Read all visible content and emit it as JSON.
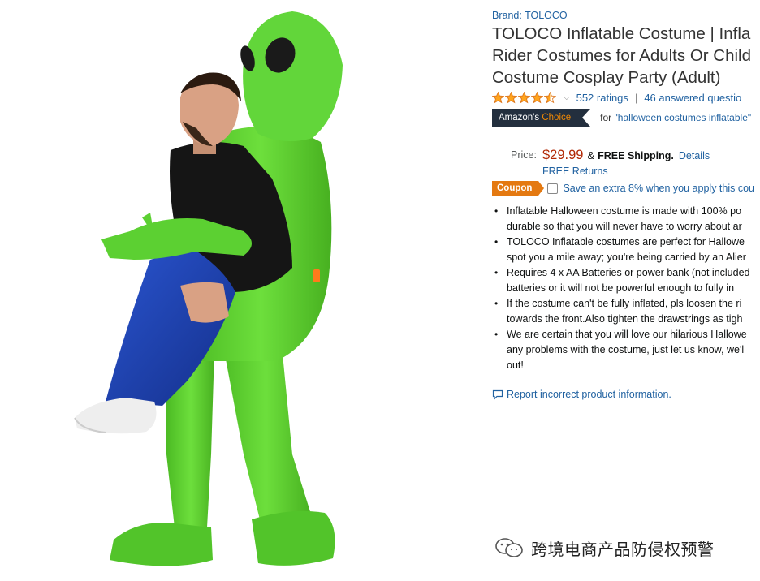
{
  "product": {
    "brand_label": "Brand: TOLOCO",
    "title_lines": [
      "TOLOCO Inflatable Costume | Infla",
      "Rider Costumes for Adults Or Child",
      "Costume Cosplay Party (Adult)"
    ],
    "rating": {
      "stars_value": 4.5,
      "stars_max": 5,
      "ratings_text": "552 ratings",
      "separator": "|",
      "answered_text": "46 answered questio"
    },
    "badge": {
      "prefix": "Amazon's",
      "highlight": "Choice",
      "for_text": "for",
      "keyword_quoted": "\"halloween costumes inflatable\""
    },
    "price": {
      "label": "Price:",
      "value": "$29.99",
      "amp": "&",
      "free_shipping": "FREE Shipping.",
      "details_link": "Details",
      "free_returns": "FREE Returns"
    },
    "coupon": {
      "badge": "Coupon",
      "text": "Save an extra 8% when you apply this cou"
    },
    "bullets": [
      [
        "Inflatable Halloween costume is made with 100% po",
        "durable so that you will never have to worry about ar"
      ],
      [
        "TOLOCO Inflatable costumes are perfect for Hallowe",
        "spot you a mile away; you're being carried by an Alier"
      ],
      [
        "Requires 4 x AA Batteries or power bank (not included",
        "batteries or it will not be powerful enough to fully in"
      ],
      [
        "If the costume can't be fully inflated, pls loosen the ri",
        "towards the front.Also tighten the drawstrings as tigh"
      ],
      [
        "We are certain that you will love our hilarious Hallowe",
        "any problems with the costume, just let us know, we'l",
        "out!"
      ]
    ],
    "report_link": "Report incorrect product information."
  },
  "watermark": {
    "text": "跨境电商产品防侵权预警"
  },
  "icons": {
    "star": "star-icon",
    "dropdown": "chevron-down-icon",
    "report": "speech-bubble-icon",
    "watermark": "wechat-logo-icon"
  },
  "colors": {
    "link": "#2162a1",
    "price": "#b12704",
    "star": "#ffa41c",
    "choice_bg": "#232f3e",
    "choice_accent": "#f08804",
    "coupon_bg": "#e47911",
    "costume_green": "#5fd235",
    "pants_blue": "#1f45b8"
  }
}
